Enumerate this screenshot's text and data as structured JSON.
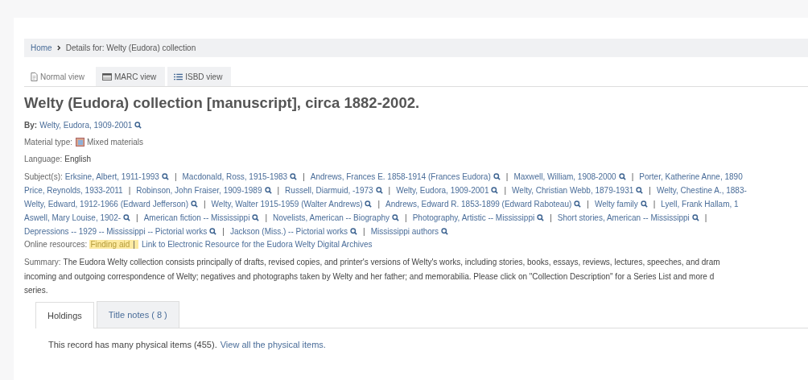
{
  "breadcrumb": [
    "Home",
    "Details for: Welty (Eudora) collection"
  ],
  "view_tabs": [
    {
      "label": "Normal view",
      "selected": true
    },
    {
      "label": "MARC view",
      "selected": false
    },
    {
      "label": "ISBD view",
      "selected": false
    }
  ],
  "title": "Welty (Eudora) collection [manuscript], circa 1882-2002.",
  "author": {
    "label": "By:",
    "name": "Welty, Eudora, 1909-2001"
  },
  "material_type": {
    "label": "Material type:",
    "value": "Mixed materials"
  },
  "language": {
    "label": "Language:",
    "value": "English"
  },
  "subjects": {
    "label": "Subject(s):",
    "lines": [
      [
        {
          "kind": "subject",
          "text": "Erksine, Albert, 1911-1993"
        },
        {
          "kind": "search"
        },
        {
          "kind": "separator",
          "text": "|"
        },
        {
          "kind": "subject",
          "text": "Macdonald, Ross, 1915-1983"
        },
        {
          "kind": "search"
        },
        {
          "kind": "separator",
          "text": "|"
        },
        {
          "kind": "subject",
          "text": "Andrews, Frances E. 1858-1914 (Frances Eudora)"
        },
        {
          "kind": "search"
        },
        {
          "kind": "separator",
          "text": "|"
        },
        {
          "kind": "subject",
          "text": "Maxwell, William, 1908-2000"
        },
        {
          "kind": "search"
        },
        {
          "kind": "separator",
          "text": "|"
        },
        {
          "kind": "subject",
          "text": "Porter, Katherine Anne, 1890"
        }
      ],
      [
        {
          "kind": "subject",
          "text": "Price, Reynolds, 1933-2011"
        },
        {
          "kind": "separator",
          "text": "|"
        },
        {
          "kind": "subject",
          "text": "Robinson, John Fraiser, 1909-1989"
        },
        {
          "kind": "search"
        },
        {
          "kind": "separator",
          "text": "|"
        },
        {
          "kind": "subject",
          "text": "Russell, Diarmuid, -1973"
        },
        {
          "kind": "search"
        },
        {
          "kind": "separator",
          "text": "|"
        },
        {
          "kind": "subject",
          "text": "Welty, Eudora, 1909-2001"
        },
        {
          "kind": "search"
        },
        {
          "kind": "separator",
          "text": "|"
        },
        {
          "kind": "subject",
          "text": "Welty, Christian Webb, 1879-1931"
        },
        {
          "kind": "search"
        },
        {
          "kind": "separator",
          "text": "|"
        },
        {
          "kind": "subject",
          "text": "Welty, Chestine A., 1883-"
        }
      ],
      [
        {
          "kind": "subject",
          "text": "Welty, Edward, 1912-1966 (Edward Jefferson)"
        },
        {
          "kind": "search"
        },
        {
          "kind": "separator",
          "text": "|"
        },
        {
          "kind": "subject",
          "text": "Welty, Walter 1915-1959 (Walter Andrews)"
        },
        {
          "kind": "search"
        },
        {
          "kind": "separator",
          "text": "|"
        },
        {
          "kind": "subject",
          "text": "Andrews, Edward R. 1853-1899 (Edward Raboteau)"
        },
        {
          "kind": "search"
        },
        {
          "kind": "separator",
          "text": "|"
        },
        {
          "kind": "subject",
          "text": "Welty family"
        },
        {
          "kind": "search"
        },
        {
          "kind": "separator",
          "text": "|"
        },
        {
          "kind": "subject",
          "text": "Lyell, Frank Hallam, 1"
        }
      ],
      [
        {
          "kind": "subject",
          "text": "Aswell, Mary Louise, 1902-"
        },
        {
          "kind": "search"
        },
        {
          "kind": "separator",
          "text": "|"
        },
        {
          "kind": "subject",
          "text": "American fiction -- Mississippi"
        },
        {
          "kind": "search"
        },
        {
          "kind": "separator",
          "text": "|"
        },
        {
          "kind": "subject",
          "text": "Novelists, American -- Biography"
        },
        {
          "kind": "search"
        },
        {
          "kind": "separator",
          "text": "|"
        },
        {
          "kind": "subject",
          "text": "Photography, Artistic -- Mississippi"
        },
        {
          "kind": "search"
        },
        {
          "kind": "separator",
          "text": "|"
        },
        {
          "kind": "subject",
          "text": "Short stories, American -- Mississippi"
        },
        {
          "kind": "search"
        },
        {
          "kind": "separator",
          "text": "|"
        }
      ],
      [
        {
          "kind": "subject",
          "text": "Depressions -- 1929 -- Mississippi -- Pictorial works"
        },
        {
          "kind": "search"
        },
        {
          "kind": "separator",
          "text": "|"
        },
        {
          "kind": "subject",
          "text": "Jackson (Miss.) -- Pictorial works"
        },
        {
          "kind": "search"
        },
        {
          "kind": "separator",
          "text": "|"
        },
        {
          "kind": "subject",
          "text": "Mississippi authors"
        },
        {
          "kind": "search"
        }
      ]
    ]
  },
  "online_resources": {
    "label": "Online resources:",
    "separator": "|",
    "links": [
      {
        "text": "Finding aid",
        "highlighted": true
      },
      {
        "text": "Link to Electronic Resource for the Eudora Welty Digital Archives",
        "highlighted": false
      }
    ]
  },
  "summary": {
    "label": "Summary:",
    "lines": [
      "The Eudora Welty collection consists principally of drafts, revised copies, and printer's versions of Welty's works, including stories, books, essays, reviews, lectures, speeches, and dram",
      "incoming and outgoing correspondence of Welty; negatives and photographs taken by Welty and her father; and memorabilia. Please click on \"Collection Description\" for a Series List and more d",
      "series."
    ]
  },
  "record_tabs": [
    {
      "label": "Holdings",
      "selected": true
    },
    {
      "label": "Title notes ( 8 )",
      "selected": false
    }
  ],
  "holdings": {
    "text": "This record has many physical items (455).",
    "link": "View all the physical items."
  }
}
